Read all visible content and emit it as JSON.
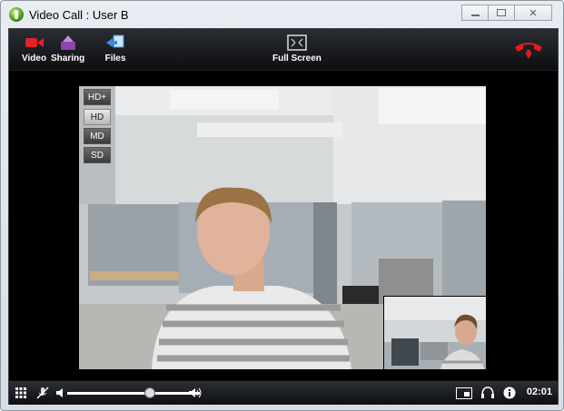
{
  "window": {
    "title": "Video Call : User B",
    "controls": {
      "minimize": "▭",
      "maximize": "□",
      "close": "✕"
    }
  },
  "toolbar": {
    "video_label": "Video",
    "sharing_label": "Sharing",
    "files_label": "Files",
    "fullscreen_label": "Full Screen"
  },
  "quality": {
    "options": [
      "HD+",
      "HD",
      "MD",
      "SD"
    ],
    "selected": "HD"
  },
  "controls": {
    "volume_level": 0.62,
    "timer": "02:01"
  },
  "colors": {
    "hangup": "#e21b1b",
    "accent_blue": "#3a8be0",
    "video_icon": "#e0242c",
    "sharing_icon": "#9b59b6"
  },
  "icons": {
    "grid": "grid-icon",
    "mic": "mic-off-icon",
    "speaker": "speaker-icon",
    "layout": "layout-icon",
    "headset": "headset-icon",
    "info": "info-icon"
  }
}
